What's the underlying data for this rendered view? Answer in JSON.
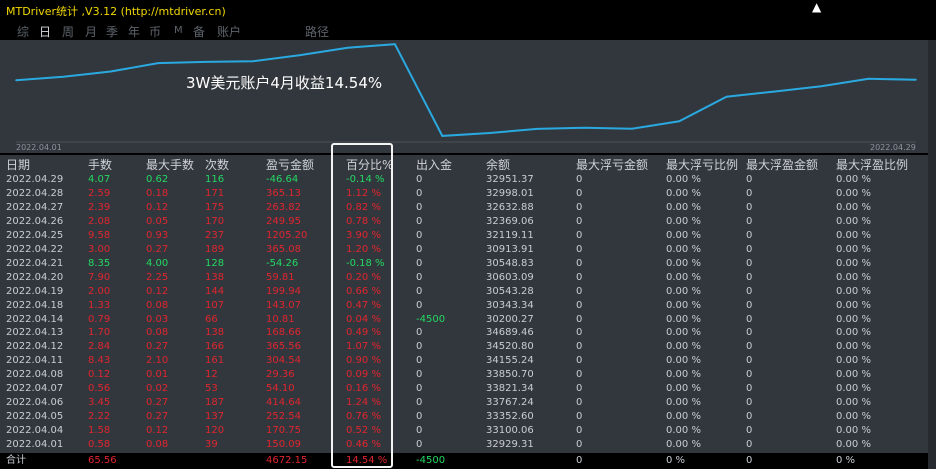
{
  "app": {
    "title": "MTDriver统计 ,V3.12 (http://mtdriver.cn)"
  },
  "tabs": [
    {
      "label": "综",
      "active": false
    },
    {
      "label": "日",
      "active": true
    },
    {
      "label": "周",
      "active": false
    },
    {
      "label": "月",
      "active": false
    },
    {
      "label": "季",
      "active": false
    },
    {
      "label": "年",
      "active": false
    },
    {
      "label": "币",
      "active": false
    },
    {
      "label": "M",
      "active": false
    },
    {
      "label": "备",
      "active": false
    },
    {
      "label": "账户",
      "active": false
    },
    {
      "label": "路径",
      "active": false
    }
  ],
  "chart_data": {
    "type": "line",
    "title": "3W美元账户4月收益14.54%",
    "x": [
      "2022.04.01",
      "2022.04.04",
      "2022.04.05",
      "2022.04.06",
      "2022.04.07",
      "2022.04.08",
      "2022.04.11",
      "2022.04.12",
      "2022.04.13",
      "2022.04.14",
      "2022.04.18",
      "2022.04.19",
      "2022.04.20",
      "2022.04.21",
      "2022.04.22",
      "2022.04.25",
      "2022.04.26",
      "2022.04.27",
      "2022.04.28",
      "2022.04.29"
    ],
    "series": [
      {
        "values": [
          32929.31,
          33100.06,
          33352.6,
          33767.24,
          33821.34,
          33850.7,
          34155.24,
          34520.8,
          34689.46,
          30200.27,
          30343.34,
          30543.28,
          30603.09,
          30548.83,
          30913.91,
          32119.11,
          32369.06,
          32632.88,
          32998.01,
          32951.37
        ]
      }
    ],
    "x_start_label": "2022.04.01",
    "x_end_label": "2022.04.29",
    "line_color": "#2aa9e0",
    "grid": false
  },
  "table": {
    "headers": [
      "日期",
      "手数",
      "最大手数",
      "次数",
      "盈亏金额",
      "百分比%",
      "出入金",
      "余额",
      "最大浮亏金额",
      "最大浮亏比例",
      "最大浮盈金额",
      "最大浮盈比例"
    ],
    "rows": [
      {
        "date": "2022.04.29",
        "lots": "4.07",
        "maxlots": "0.62",
        "count": "116",
        "pnl": "-46.64",
        "pct": "-0.14 %",
        "io": "0",
        "bal": "32951.37",
        "mfl": "0",
        "mflp": "0.00 %",
        "mfp": "0",
        "mfpp": "0.00 %",
        "color": "g"
      },
      {
        "date": "2022.04.28",
        "lots": "2.59",
        "maxlots": "0.18",
        "count": "171",
        "pnl": "365.13",
        "pct": "1.12 %",
        "io": "0",
        "bal": "32998.01",
        "mfl": "0",
        "mflp": "0.00 %",
        "mfp": "0",
        "mfpp": "0.00 %",
        "color": "r"
      },
      {
        "date": "2022.04.27",
        "lots": "2.39",
        "maxlots": "0.12",
        "count": "175",
        "pnl": "263.82",
        "pct": "0.82 %",
        "io": "0",
        "bal": "32632.88",
        "mfl": "0",
        "mflp": "0.00 %",
        "mfp": "0",
        "mfpp": "0.00 %",
        "color": "r"
      },
      {
        "date": "2022.04.26",
        "lots": "2.08",
        "maxlots": "0.05",
        "count": "170",
        "pnl": "249.95",
        "pct": "0.78 %",
        "io": "0",
        "bal": "32369.06",
        "mfl": "0",
        "mflp": "0.00 %",
        "mfp": "0",
        "mfpp": "0.00 %",
        "color": "r"
      },
      {
        "date": "2022.04.25",
        "lots": "9.58",
        "maxlots": "0.93",
        "count": "237",
        "pnl": "1205.20",
        "pct": "3.90 %",
        "io": "0",
        "bal": "32119.11",
        "mfl": "0",
        "mflp": "0.00 %",
        "mfp": "0",
        "mfpp": "0.00 %",
        "color": "r"
      },
      {
        "date": "2022.04.22",
        "lots": "3.00",
        "maxlots": "0.27",
        "count": "189",
        "pnl": "365.08",
        "pct": "1.20 %",
        "io": "0",
        "bal": "30913.91",
        "mfl": "0",
        "mflp": "0.00 %",
        "mfp": "0",
        "mfpp": "0.00 %",
        "color": "r"
      },
      {
        "date": "2022.04.21",
        "lots": "8.35",
        "maxlots": "4.00",
        "count": "128",
        "pnl": "-54.26",
        "pct": "-0.18 %",
        "io": "0",
        "bal": "30548.83",
        "mfl": "0",
        "mflp": "0.00 %",
        "mfp": "0",
        "mfpp": "0.00 %",
        "color": "g"
      },
      {
        "date": "2022.04.20",
        "lots": "7.90",
        "maxlots": "2.25",
        "count": "138",
        "pnl": "59.81",
        "pct": "0.20 %",
        "io": "0",
        "bal": "30603.09",
        "mfl": "0",
        "mflp": "0.00 %",
        "mfp": "0",
        "mfpp": "0.00 %",
        "color": "r"
      },
      {
        "date": "2022.04.19",
        "lots": "2.00",
        "maxlots": "0.12",
        "count": "144",
        "pnl": "199.94",
        "pct": "0.66 %",
        "io": "0",
        "bal": "30543.28",
        "mfl": "0",
        "mflp": "0.00 %",
        "mfp": "0",
        "mfpp": "0.00 %",
        "color": "r"
      },
      {
        "date": "2022.04.18",
        "lots": "1.33",
        "maxlots": "0.08",
        "count": "107",
        "pnl": "143.07",
        "pct": "0.47 %",
        "io": "0",
        "bal": "30343.34",
        "mfl": "0",
        "mflp": "0.00 %",
        "mfp": "0",
        "mfpp": "0.00 %",
        "color": "r"
      },
      {
        "date": "2022.04.14",
        "lots": "0.79",
        "maxlots": "0.03",
        "count": "66",
        "pnl": "10.81",
        "pct": "0.04 %",
        "io": "-4500",
        "bal": "30200.27",
        "mfl": "0",
        "mflp": "0.00 %",
        "mfp": "0",
        "mfpp": "0.00 %",
        "color": "r"
      },
      {
        "date": "2022.04.13",
        "lots": "1.70",
        "maxlots": "0.08",
        "count": "138",
        "pnl": "168.66",
        "pct": "0.49 %",
        "io": "0",
        "bal": "34689.46",
        "mfl": "0",
        "mflp": "0.00 %",
        "mfp": "0",
        "mfpp": "0.00 %",
        "color": "r"
      },
      {
        "date": "2022.04.12",
        "lots": "2.84",
        "maxlots": "0.27",
        "count": "166",
        "pnl": "365.56",
        "pct": "1.07 %",
        "io": "0",
        "bal": "34520.80",
        "mfl": "0",
        "mflp": "0.00 %",
        "mfp": "0",
        "mfpp": "0.00 %",
        "color": "r"
      },
      {
        "date": "2022.04.11",
        "lots": "8.43",
        "maxlots": "2.10",
        "count": "161",
        "pnl": "304.54",
        "pct": "0.90 %",
        "io": "0",
        "bal": "34155.24",
        "mfl": "0",
        "mflp": "0.00 %",
        "mfp": "0",
        "mfpp": "0.00 %",
        "color": "r"
      },
      {
        "date": "2022.04.08",
        "lots": "0.12",
        "maxlots": "0.01",
        "count": "12",
        "pnl": "29.36",
        "pct": "0.09 %",
        "io": "0",
        "bal": "33850.70",
        "mfl": "0",
        "mflp": "0.00 %",
        "mfp": "0",
        "mfpp": "0.00 %",
        "color": "r"
      },
      {
        "date": "2022.04.07",
        "lots": "0.56",
        "maxlots": "0.02",
        "count": "53",
        "pnl": "54.10",
        "pct": "0.16 %",
        "io": "0",
        "bal": "33821.34",
        "mfl": "0",
        "mflp": "0.00 %",
        "mfp": "0",
        "mfpp": "0.00 %",
        "color": "r"
      },
      {
        "date": "2022.04.06",
        "lots": "3.45",
        "maxlots": "0.27",
        "count": "187",
        "pnl": "414.64",
        "pct": "1.24 %",
        "io": "0",
        "bal": "33767.24",
        "mfl": "0",
        "mflp": "0.00 %",
        "mfp": "0",
        "mfpp": "0.00 %",
        "color": "r"
      },
      {
        "date": "2022.04.05",
        "lots": "2.22",
        "maxlots": "0.27",
        "count": "137",
        "pnl": "252.54",
        "pct": "0.76 %",
        "io": "0",
        "bal": "33352.60",
        "mfl": "0",
        "mflp": "0.00 %",
        "mfp": "0",
        "mfpp": "0.00 %",
        "color": "r"
      },
      {
        "date": "2022.04.04",
        "lots": "1.58",
        "maxlots": "0.12",
        "count": "120",
        "pnl": "170.75",
        "pct": "0.52 %",
        "io": "0",
        "bal": "33100.06",
        "mfl": "0",
        "mflp": "0.00 %",
        "mfp": "0",
        "mfpp": "0.00 %",
        "color": "r"
      },
      {
        "date": "2022.04.01",
        "lots": "0.58",
        "maxlots": "0.08",
        "count": "39",
        "pnl": "150.09",
        "pct": "0.46 %",
        "io": "0",
        "bal": "32929.31",
        "mfl": "0",
        "mflp": "0.00 %",
        "mfp": "0",
        "mfpp": "0.00 %",
        "color": "r"
      }
    ],
    "footer": {
      "label": "合计",
      "lots": "65.56",
      "pnl": "4672.15",
      "pct": "14.54 %",
      "io": "-4500",
      "mfl": "0",
      "mflp": "0 %",
      "mfp": "0",
      "mfpp": "0 %"
    }
  },
  "colors": {
    "profit": "#e0252f",
    "loss": "#23d862",
    "accent": "#f0d800",
    "highlight_box": "#f4f4f4"
  }
}
